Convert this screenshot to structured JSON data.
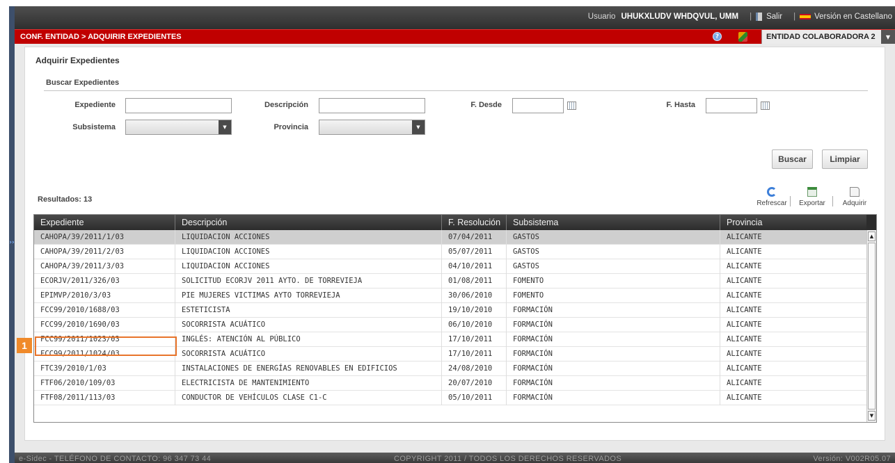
{
  "topbar": {
    "user_label": "Usuario",
    "user_name": "UHUKXLUDV WHDQVUL, UMM",
    "sep": "|",
    "logout": "Salir",
    "language": "Versión en Castellano"
  },
  "breadcrumb": "CONF. ENTIDAD > ADQUIRIR EXPEDIENTES",
  "entity": {
    "value": "ENTIDAD COLABORADORA 2"
  },
  "page_title": "Adquirir Expedientes",
  "search": {
    "title": "Buscar Expedientes",
    "expediente_label": "Expediente",
    "expediente_value": "",
    "descripcion_label": "Descripción",
    "descripcion_value": "",
    "fdesde_label": "F. Desde",
    "fdesde_value": "",
    "fhasta_label": "F. Hasta",
    "fhasta_value": "",
    "subsistema_label": "Subsistema",
    "subsistema_value": "",
    "provincia_label": "Provincia",
    "provincia_value": "",
    "buscar_button": "Buscar",
    "limpiar_button": "Limpiar"
  },
  "results_label": "Resultados: 13",
  "toolbar": {
    "refresh": "Refrescar",
    "export": "Exportar",
    "acquire": "Adquirir"
  },
  "grid": {
    "columns": [
      "Expediente",
      "Descripción",
      "F. Resolución",
      "Subsistema",
      "Provincia"
    ],
    "rows": [
      [
        "CAHOPA/39/2011/1/03",
        "LIQUIDACION ACCIONES",
        "07/04/2011",
        "GASTOS",
        "ALICANTE"
      ],
      [
        "CAHOPA/39/2011/2/03",
        "LIQUIDACION ACCIONES",
        "05/07/2011",
        "GASTOS",
        "ALICANTE"
      ],
      [
        "CAHOPA/39/2011/3/03",
        "LIQUIDACION ACCIONES",
        "04/10/2011",
        "GASTOS",
        "ALICANTE"
      ],
      [
        "ECORJV/2011/326/03",
        "SOLICITUD ECORJV 2011 AYTO. DE TORREVIEJA",
        "01/08/2011",
        "FOMENTO",
        "ALICANTE"
      ],
      [
        "EPIMVP/2010/3/03",
        "PIE MUJERES VICTIMAS AYTO TORREVIEJA",
        "30/06/2010",
        "FOMENTO",
        "ALICANTE"
      ],
      [
        "FCC99/2010/1688/03",
        "ESTETICISTA",
        "19/10/2010",
        "FORMACIÓN",
        "ALICANTE"
      ],
      [
        "FCC99/2010/1690/03",
        "SOCORRISTA ACUÁTICO",
        "06/10/2010",
        "FORMACIÓN",
        "ALICANTE"
      ],
      [
        "FCC99/2011/1023/03",
        "INGLÉS: ATENCIÓN AL PÚBLICO",
        "17/10/2011",
        "FORMACIÓN",
        "ALICANTE"
      ],
      [
        "FCC99/2011/1024/03",
        "SOCORRISTA ACUÁTICO",
        "17/10/2011",
        "FORMACIÓN",
        "ALICANTE"
      ],
      [
        "FTC39/2010/1/03",
        "INSTALACIONES DE ENERGÍAS RENOVABLES EN EDIFICIOS",
        "24/08/2010",
        "FORMACIÓN",
        "ALICANTE"
      ],
      [
        "FTF06/2010/109/03",
        "ELECTRICISTA DE MANTENIMIENTO",
        "20/07/2010",
        "FORMACIÓN",
        "ALICANTE"
      ],
      [
        "FTF08/2011/113/03",
        "CONDUCTOR DE VEHÍCULOS CLASE C1-C",
        "05/10/2011",
        "FORMACIÓN",
        "ALICANTE"
      ]
    ],
    "selected_row": 0
  },
  "callout": {
    "number": "1"
  },
  "footer": {
    "contact": "e-Sidec - TELÉFONO DE CONTACTO: 96 347 73 44",
    "copyright": "COPYRIGHT 2011 / TODOS LOS DERECHOS RESERVADOS",
    "version": "Versión: V002R05.07"
  },
  "colors": {
    "accent_red": "#c00000",
    "callout_orange": "#f08a2a",
    "header_dark": "#2c2c2c"
  },
  "icons": [
    "help-icon",
    "tools-icon",
    "calendar-icon",
    "refresh-icon",
    "excel-icon",
    "acquire-doc-icon",
    "logout-door-icon",
    "spain-flag-icon",
    "chevron-down-icon"
  ]
}
